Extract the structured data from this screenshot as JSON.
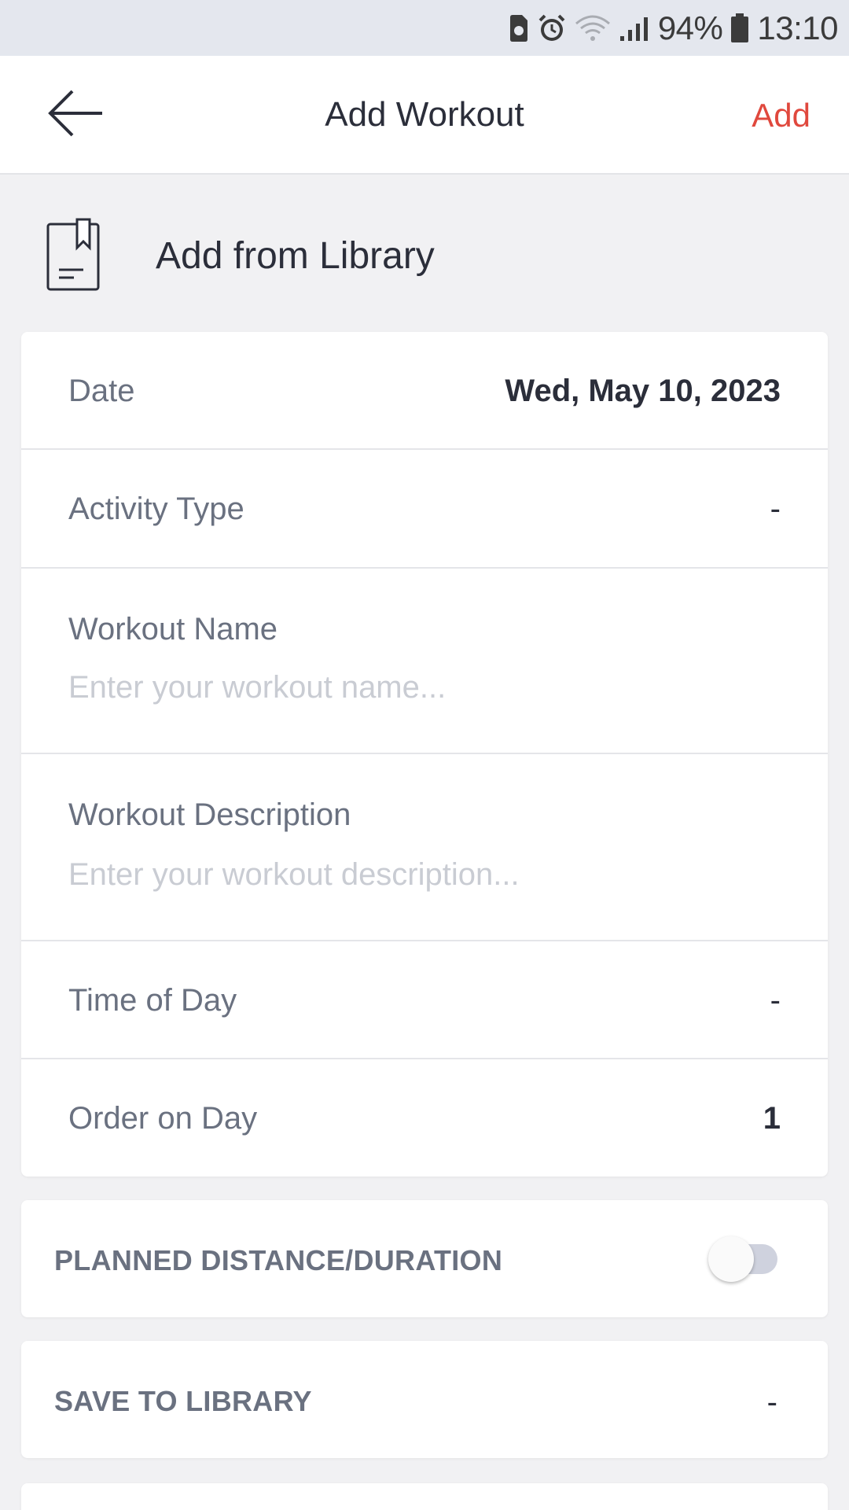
{
  "status_bar": {
    "battery": "94%",
    "time": "13:10",
    "icons": [
      "sim-card-icon",
      "alarm-icon",
      "wifi-icon",
      "signal-icon",
      "battery-icon"
    ]
  },
  "header": {
    "title": "Add Workout",
    "action_label": "Add",
    "back_icon": "arrow-left-icon"
  },
  "library": {
    "label": "Add from Library",
    "icon": "bookmark-document-icon"
  },
  "form": {
    "date": {
      "label": "Date",
      "value": "Wed, May 10, 2023"
    },
    "activity_type": {
      "label": "Activity Type",
      "value": "-"
    },
    "workout_name": {
      "label": "Workout Name",
      "placeholder": "Enter your workout name...",
      "value": ""
    },
    "workout_description": {
      "label": "Workout Description",
      "placeholder": "Enter your workout description...",
      "value": ""
    },
    "time_of_day": {
      "label": "Time of Day",
      "value": "-"
    },
    "order_on_day": {
      "label": "Order on Day",
      "value": "1"
    }
  },
  "planned": {
    "label": "PLANNED DISTANCE/DURATION",
    "toggle_on": false
  },
  "save_library": {
    "label": "SAVE TO LIBRARY",
    "value": "-"
  },
  "colors": {
    "accent": "#e0483d",
    "background": "#f1f1f3",
    "card": "#ffffff",
    "label": "#6a7180",
    "placeholder": "#c9ccd3"
  }
}
